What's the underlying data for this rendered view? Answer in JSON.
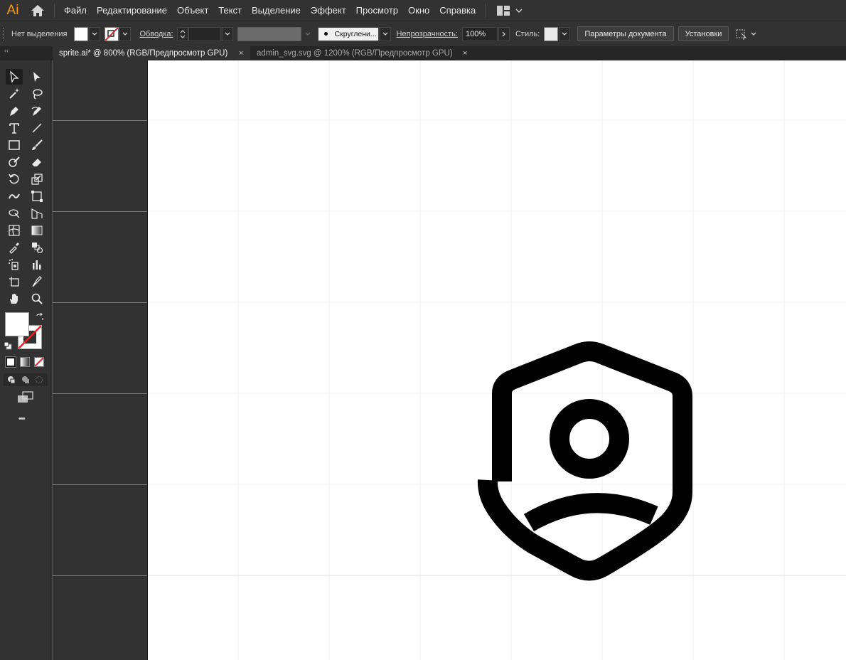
{
  "app": {
    "logo_text": "Ai",
    "accent_color": "#ff9a00"
  },
  "menu": {
    "items": [
      "Файл",
      "Редактирование",
      "Объект",
      "Текст",
      "Выделение",
      "Эффект",
      "Просмотр",
      "Окно",
      "Справка"
    ]
  },
  "control_bar": {
    "selection_label": "Нет выделения",
    "stroke_label": "Обводка:",
    "brush_label": "Скруглени...",
    "opacity_label": "Непрозрачность:",
    "opacity_value": "100%",
    "style_label": "Стиль:",
    "doc_settings_button": "Параметры документа",
    "preferences_button": "Установки"
  },
  "tabs": [
    {
      "label": "sprite.ai* @ 800% (RGB/Предпросмотр GPU)",
      "close": "×",
      "active": true
    },
    {
      "label": "admin_svg.svg @ 1200% (RGB/Предпросмотр GPU)",
      "close": "×",
      "active": false
    }
  ],
  "toolbar": {
    "more_label": "•••",
    "fill_color": "#ffffff"
  },
  "canvas": {
    "artboard_color": "#ffffff",
    "artwork_name": "shield-user-icon"
  }
}
